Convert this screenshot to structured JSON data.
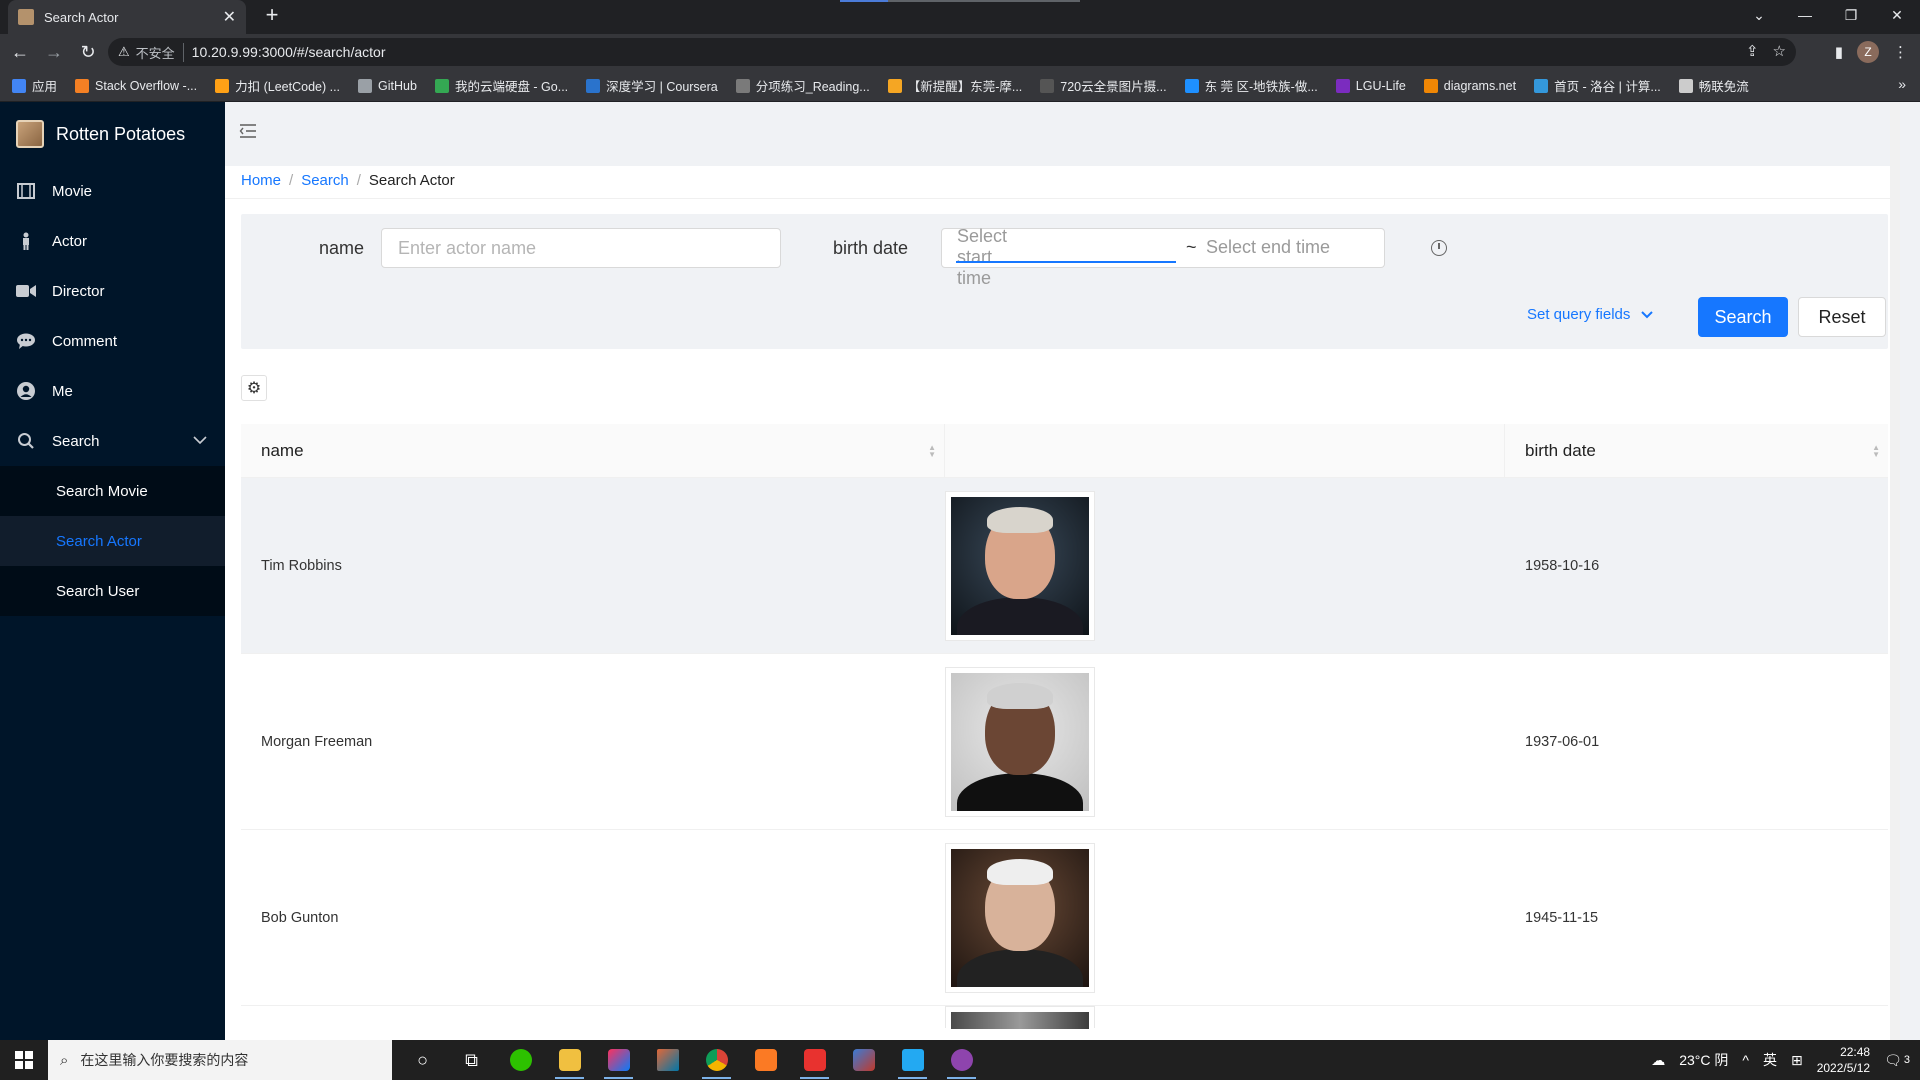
{
  "browser": {
    "tab_title": "Search Actor",
    "new_tab": "+",
    "close_tab": "✕",
    "security_label": "不安全",
    "url": "10.20.9.99:3000/#/search/actor",
    "profile_initial": "Z",
    "bookmarks": [
      {
        "label": "应用",
        "color": "#4285f4"
      },
      {
        "label": "Stack Overflow -...",
        "color": "#f48024"
      },
      {
        "label": "力扣 (LeetCode) ...",
        "color": "#ffa116"
      },
      {
        "label": "GitHub",
        "color": "#9aa0a6"
      },
      {
        "label": "我的云端硬盘 - Go...",
        "color": "#34a853"
      },
      {
        "label": "深度学习 | Coursera",
        "color": "#2a73cc"
      },
      {
        "label": "分项练习_Reading...",
        "color": "#7a7a7a"
      },
      {
        "label": "【新提醒】东莞-摩...",
        "color": "#f5a623"
      },
      {
        "label": "720云全景图片摄...",
        "color": "#555555"
      },
      {
        "label": "东 莞 区-地铁族-做...",
        "color": "#1e90ff"
      },
      {
        "label": "LGU-Life",
        "color": "#7b2cbf"
      },
      {
        "label": "diagrams.net",
        "color": "#f08705"
      },
      {
        "label": "首页 - 洛谷 | 计算...",
        "color": "#3498db"
      },
      {
        "label": "畅联免流",
        "color": "#cccccc"
      }
    ]
  },
  "app": {
    "name": "Rotten Potatoes",
    "menu": [
      {
        "label": "Movie",
        "icon": "film-icon"
      },
      {
        "label": "Actor",
        "icon": "person-icon"
      },
      {
        "label": "Director",
        "icon": "video-camera-icon"
      },
      {
        "label": "Comment",
        "icon": "chat-bubble-icon"
      },
      {
        "label": "Me",
        "icon": "user-circle-icon"
      }
    ],
    "search_menu": {
      "label": "Search",
      "items": [
        "Search Movie",
        "Search Actor",
        "Search User"
      ],
      "active": "Search Actor"
    }
  },
  "breadcrumb": {
    "home": "Home",
    "search": "Search",
    "current": "Search Actor",
    "separator": "/"
  },
  "form": {
    "name_label": "name",
    "name_placeholder": "Enter actor name",
    "birth_label": "birth date",
    "start_placeholder": "Select start time",
    "range_separator": "~",
    "end_placeholder": "Select end time",
    "set_query_fields": "Set query fields",
    "search_button": "Search",
    "reset_button": "Reset"
  },
  "table": {
    "columns": [
      "name",
      "",
      "birth date"
    ],
    "rows": [
      {
        "name": "Tim Robbins",
        "birth_date": "1958-10-16",
        "photo": "actor-photo"
      },
      {
        "name": "Morgan Freeman",
        "birth_date": "1937-06-01",
        "photo": "actor-photo"
      },
      {
        "name": "Bob Gunton",
        "birth_date": "1945-11-15",
        "photo": "actor-photo"
      }
    ]
  },
  "taskbar": {
    "search_placeholder": "在这里输入你要搜索的内容",
    "weather": "23°C 阴",
    "ime": "英",
    "time": "22:48",
    "date": "2022/5/12",
    "notifications": "3"
  },
  "colors": {
    "primary": "#1677ff",
    "sider": "#001529",
    "sub_menu": "#000c17"
  }
}
